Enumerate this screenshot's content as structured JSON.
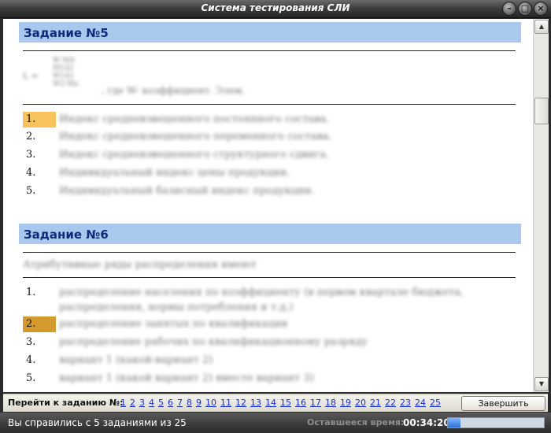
{
  "window": {
    "title": "Система тестирования СЛИ"
  },
  "task5": {
    "header": "Задание №5",
    "formula": {
      "part1": "L =",
      "part2": "W·MA\nM1A1\nW1A1\nW2·Ma",
      "part3": ", где W- коэффициент. Элем."
    },
    "options": [
      {
        "num": "1.",
        "text": "Индекс средневзвешенного постоянного состава."
      },
      {
        "num": "2.",
        "text": "Индекс средневзвешенного переменного состава."
      },
      {
        "num": "3.",
        "text": "Индекс средневзвешенного структурного сдвига."
      },
      {
        "num": "4.",
        "text": "Индивидуальный индекс цены продукции."
      },
      {
        "num": "5.",
        "text": "Индивидуальный базисный индекс продукции."
      }
    ]
  },
  "task6": {
    "header": "Задание №6",
    "question": "Атрибутивные ряды распределения имеют",
    "options": [
      {
        "num": "1.",
        "text": "распределение населения по коэффициенту (в первом квартале бюджета,",
        "text2": "распределения, нормы потребления и т.д.)"
      },
      {
        "num": "2.",
        "text": "распределение занятых по квалификации"
      },
      {
        "num": "3.",
        "text": "распределение рабочих по квалификационному разряду"
      },
      {
        "num": "4.",
        "text": "вариант 1 (какой-вариант 2)"
      },
      {
        "num": "5.",
        "text": "вариант 1 (какой вариант 2) вместе вариант 3)"
      }
    ]
  },
  "nav": {
    "label": "Перейти к заданию №:",
    "pages": [
      "1",
      "2",
      "3",
      "4",
      "5",
      "6",
      "7",
      "8",
      "9",
      "10",
      "11",
      "12",
      "13",
      "14",
      "15",
      "16",
      "17",
      "18",
      "19",
      "20",
      "21",
      "22",
      "23",
      "24",
      "25"
    ],
    "finish_label": "Завершить"
  },
  "status": {
    "done_text": "Вы справились с 5 заданиями из 25",
    "remaining_label": "Оставшееся время:",
    "remaining_time": "00:34:20",
    "progress": 0.13
  },
  "colors": {
    "header_bg": "#a8c8ee",
    "header_text": "#102a7a",
    "selected_option": "#f8c35d",
    "selected_option_dark": "#d49a2e",
    "link": "#1a2fd0"
  }
}
